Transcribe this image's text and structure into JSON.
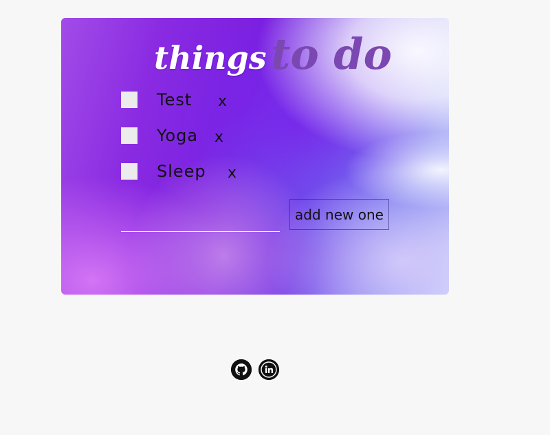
{
  "card": {
    "title_part1": "things",
    "title_part2": "to do"
  },
  "todos": [
    {
      "label": "Test",
      "delete_label": "x",
      "checked": false
    },
    {
      "label": "Yoga",
      "delete_label": "x",
      "checked": false
    },
    {
      "label": "Sleep",
      "delete_label": "x",
      "checked": false
    }
  ],
  "new_todo": {
    "value": "",
    "placeholder": "",
    "button_label": "add new one"
  },
  "footer": {
    "links": [
      {
        "icon": "github-icon"
      },
      {
        "icon": "linkedin-icon"
      }
    ]
  },
  "colors": {
    "page_background": "#f7f7f7",
    "title_primary": "#ffffff",
    "title_accent": "#7b47b0",
    "checkbox": "#ececec"
  }
}
